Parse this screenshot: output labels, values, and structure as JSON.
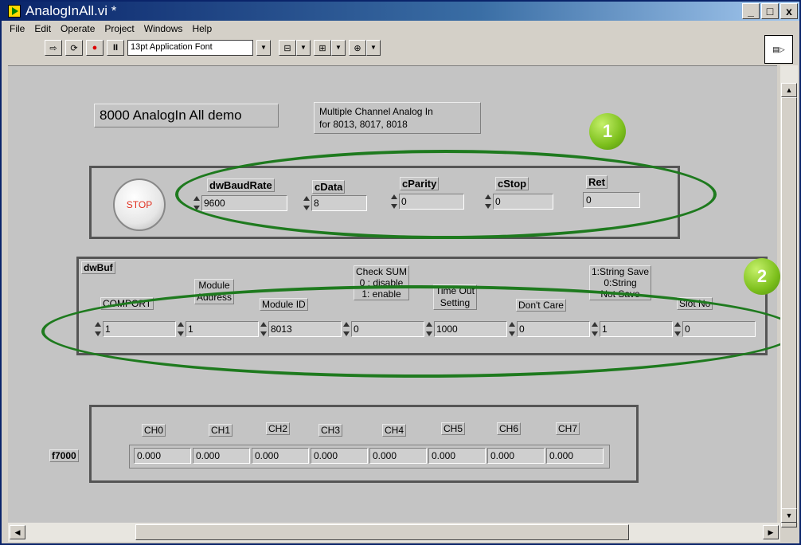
{
  "window": {
    "title": "AnalogInAll.vi *"
  },
  "menu": [
    "File",
    "Edit",
    "Operate",
    "Project",
    "Windows",
    "Help"
  ],
  "toolbar": {
    "font": "13pt Application Font"
  },
  "panel": {
    "title_label": "8000 AnalogIn All demo",
    "desc_line1": "Multiple Channel Analog In",
    "desc_line2": "for 8013, 8017, 8018",
    "stop_label": "STOP",
    "comm": [
      {
        "label": "dwBaudRate",
        "value": "9600"
      },
      {
        "label": "cData",
        "value": "8"
      },
      {
        "label": "cParity",
        "value": "0"
      },
      {
        "label": "cStop",
        "value": "0"
      },
      {
        "label": "Ret",
        "value": "0"
      }
    ],
    "dwbuf_label": "dwBuf",
    "dwbuf": [
      {
        "label": "COMPORT",
        "value": "1"
      },
      {
        "label1": "Module",
        "label2": "Address",
        "value": "1"
      },
      {
        "label": "Module ID",
        "value": "8013"
      },
      {
        "label1": "Check SUM",
        "label2": "0 : disable",
        "label3": "1: enable",
        "value": "0"
      },
      {
        "label1": "Time Out",
        "label2": "Setting",
        "value": "1000"
      },
      {
        "label": "Don't Care",
        "value": "0"
      },
      {
        "label1": "1:String Save",
        "label2": "0:String",
        "label3": "Not Save",
        "value": "1"
      },
      {
        "label": "Slot No",
        "value": "0"
      }
    ],
    "f7000_label": "f7000",
    "channels": [
      {
        "label": "CH0",
        "value": "0.000"
      },
      {
        "label": "CH1",
        "value": "0.000"
      },
      {
        "label": "CH2",
        "value": "0.000"
      },
      {
        "label": "CH3",
        "value": "0.000"
      },
      {
        "label": "CH4",
        "value": "0.000"
      },
      {
        "label": "CH5",
        "value": "0.000"
      },
      {
        "label": "CH6",
        "value": "0.000"
      },
      {
        "label": "CH7",
        "value": "0.000"
      }
    ]
  },
  "callouts": {
    "one": "1",
    "two": "2"
  },
  "colors": {
    "ellipse": "#1e7a1e",
    "badge": "#7cbf1c",
    "stop_text": "#e03020"
  }
}
